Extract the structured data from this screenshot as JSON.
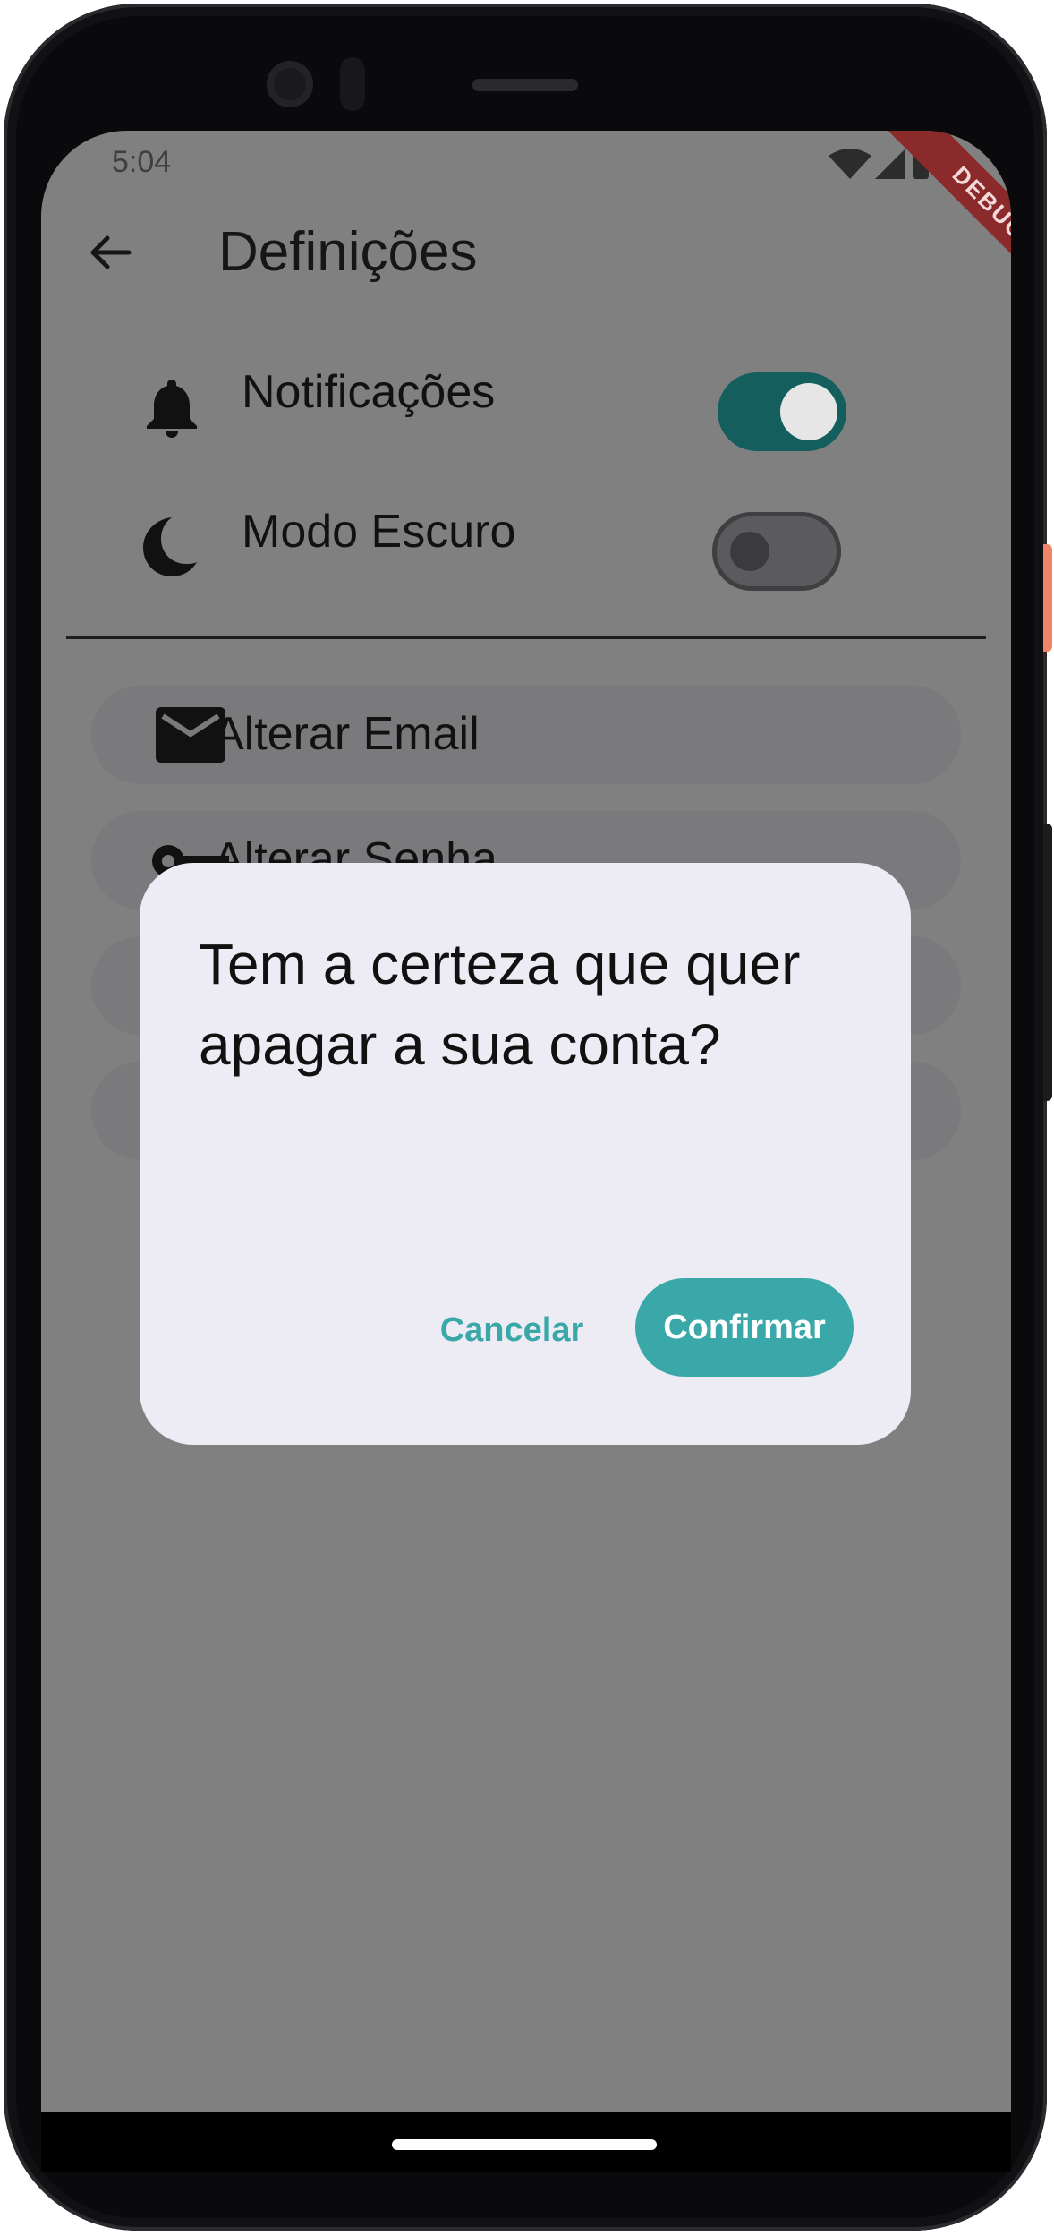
{
  "status_bar": {
    "time": "5:04"
  },
  "debug_banner": "DEBUG",
  "app_bar": {
    "title": "Definições"
  },
  "settings": {
    "notifications": {
      "label": "Notificações",
      "enabled": true
    },
    "dark_mode": {
      "label": "Modo Escuro",
      "enabled": false
    }
  },
  "actions": [
    {
      "label": "Alterar Email",
      "icon": "email-icon"
    },
    {
      "label": "Alterar Senha",
      "icon": "key-icon"
    }
  ],
  "dialog": {
    "message": "Tem a certeza que quer apagar a sua conta?",
    "cancel_label": "Cancelar",
    "confirm_label": "Confirmar"
  },
  "colors": {
    "accent": "#3aa8a8",
    "switch_on": "#155e5e",
    "scrim_bg": "#808080",
    "dialog_bg": "#edebf3"
  }
}
